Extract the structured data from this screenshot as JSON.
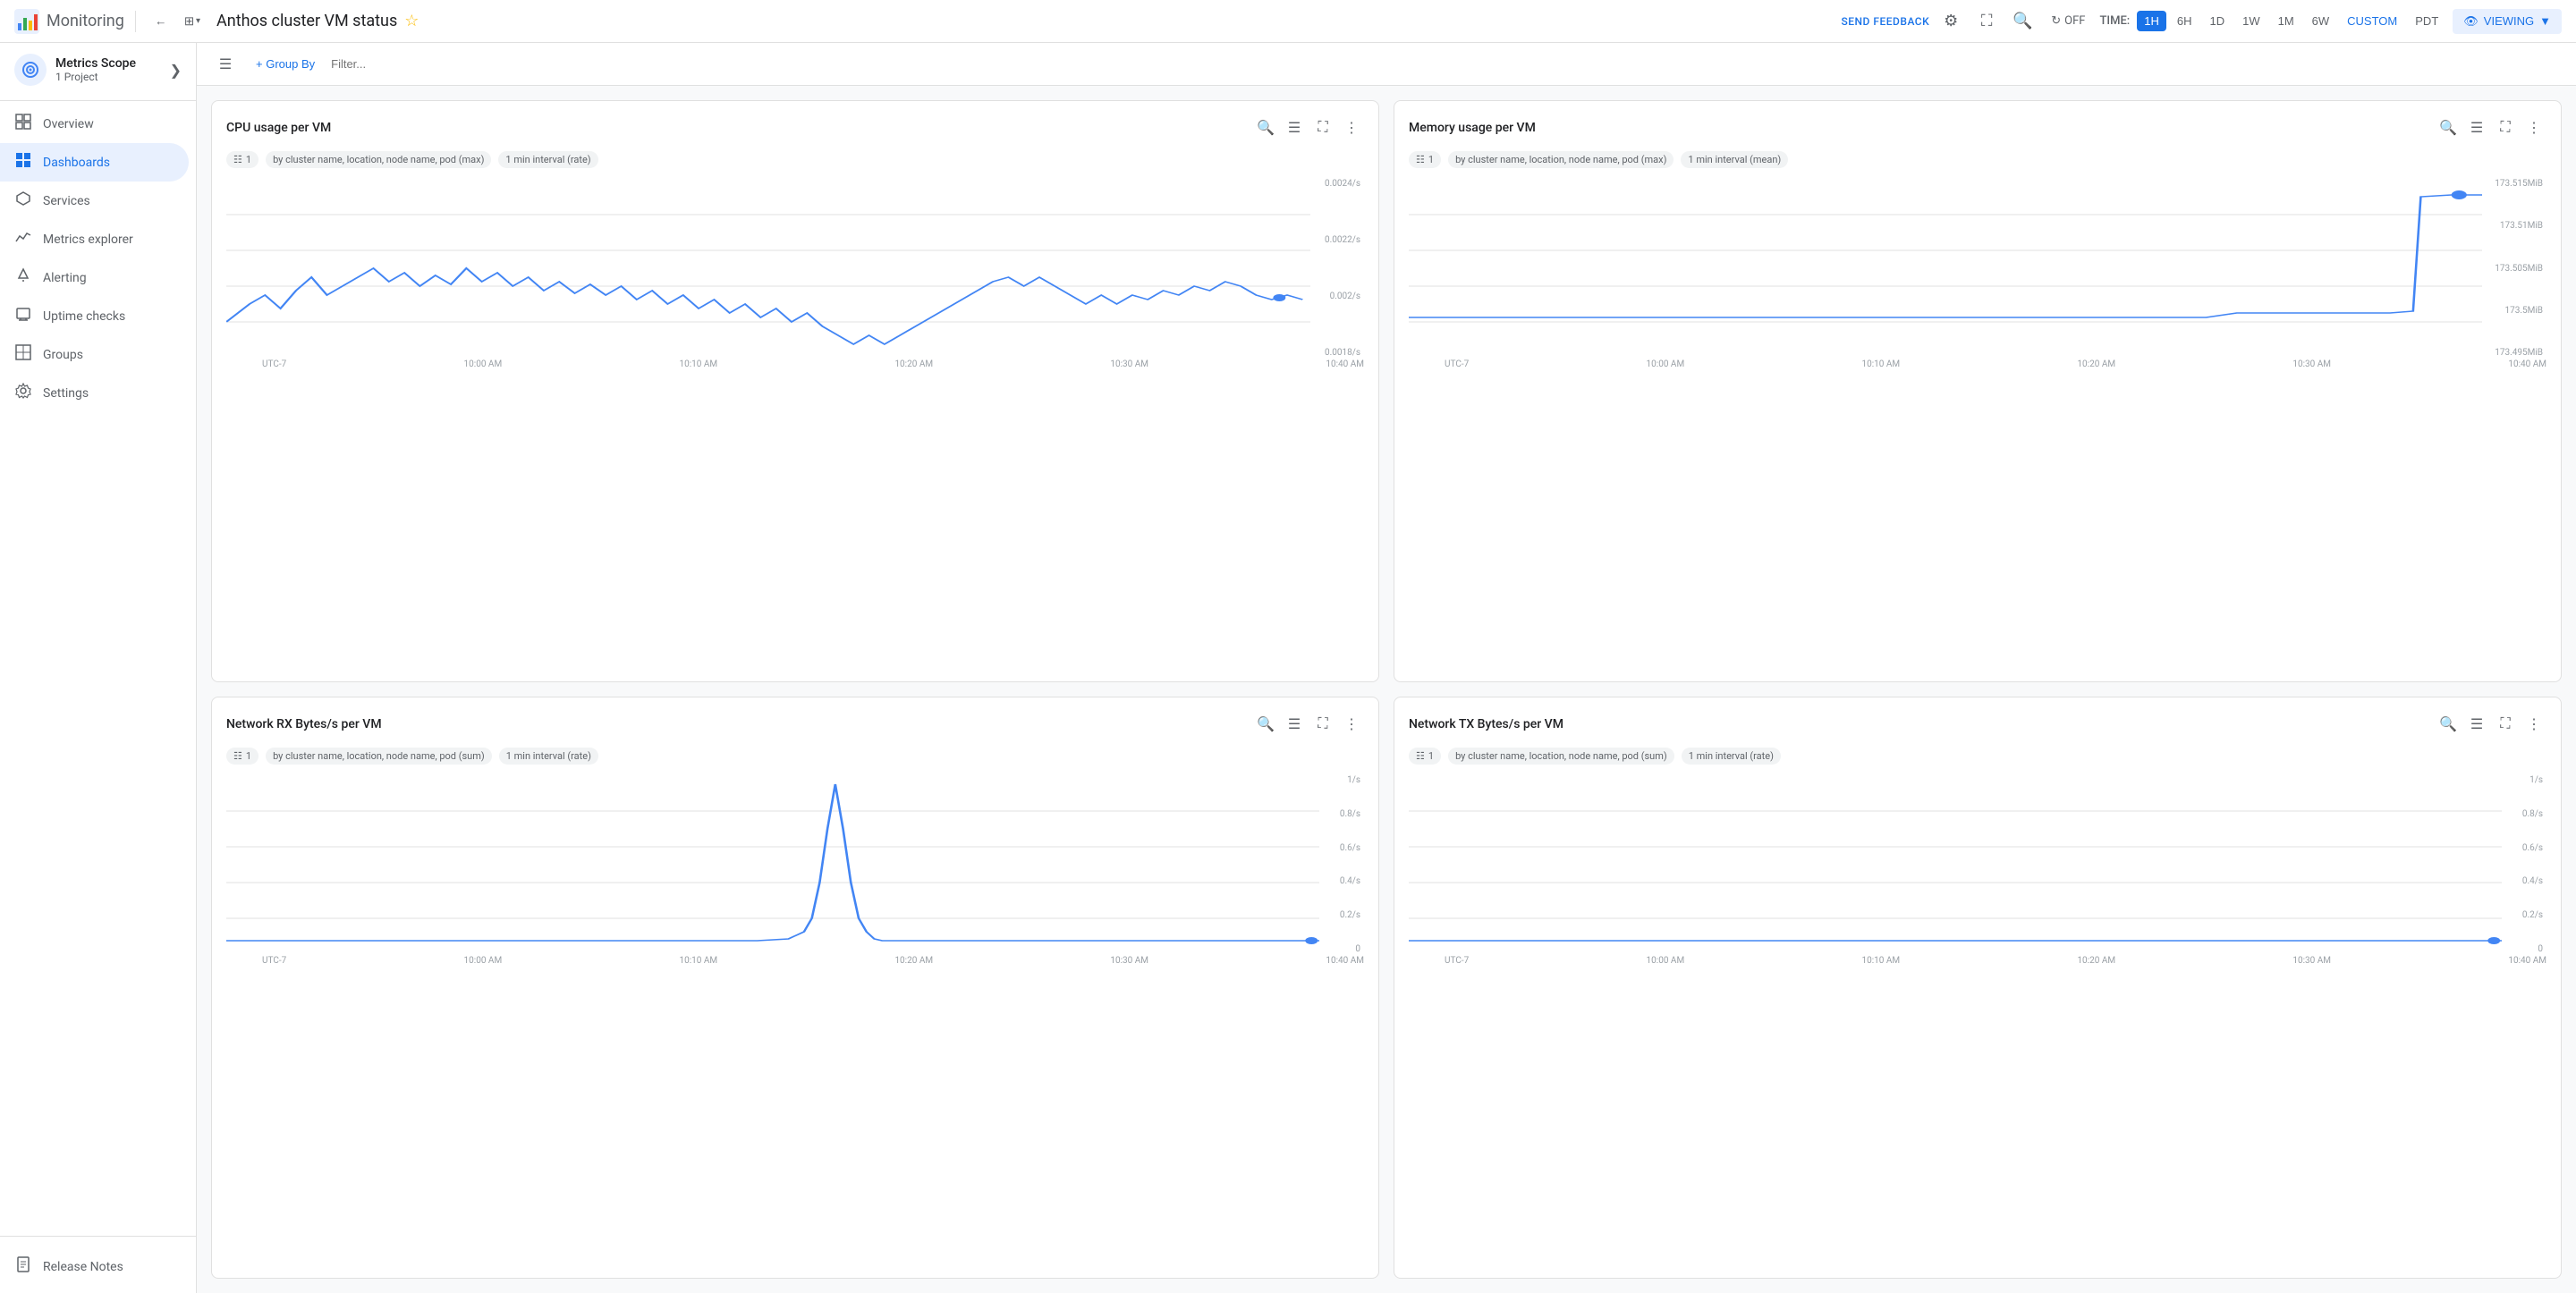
{
  "topbar": {
    "app_name": "Monitoring",
    "title": "Anthos cluster VM status",
    "feedback_label": "SEND FEEDBACK",
    "time_label": "TIME:",
    "time_options": [
      "1H",
      "6H",
      "1D",
      "1W",
      "1M",
      "6W",
      "CUSTOM",
      "PDT"
    ],
    "time_active": "1H",
    "refresh_label": "OFF",
    "viewing_label": "VIEWING"
  },
  "sidebar": {
    "header_title": "Metrics Scope",
    "header_sub": "1 Project",
    "items": [
      {
        "label": "Overview",
        "icon": "📊"
      },
      {
        "label": "Dashboards",
        "icon": "▦"
      },
      {
        "label": "Services",
        "icon": "⚡"
      },
      {
        "label": "Metrics explorer",
        "icon": "📈"
      },
      {
        "label": "Alerting",
        "icon": "🔔"
      },
      {
        "label": "Uptime checks",
        "icon": "🖥"
      },
      {
        "label": "Groups",
        "icon": "▣"
      },
      {
        "label": "Settings",
        "icon": "⚙"
      }
    ],
    "bottom_item": "Release Notes"
  },
  "toolbar": {
    "group_by": "+ Group By",
    "filter_placeholder": "Filter..."
  },
  "charts": [
    {
      "id": "cpu",
      "title": "CPU usage per VM",
      "tag1": "1",
      "tag2": "by cluster name, location, node name, pod (max)",
      "tag3": "1 min interval (rate)",
      "y_labels": [
        "0.0024/s",
        "0.0022/s",
        "0.002/s",
        "0.0018/s"
      ],
      "x_labels": [
        "UTC-7",
        "10:00 AM",
        "10:10 AM",
        "10:20 AM",
        "10:30 AM",
        "10:40 AM"
      ]
    },
    {
      "id": "memory",
      "title": "Memory usage per VM",
      "tag1": "1",
      "tag2": "by cluster name, location, node name, pod (max)",
      "tag3": "1 min interval (mean)",
      "y_labels": [
        "173.515MiB",
        "173.51MiB",
        "173.505MiB",
        "173.5MiB",
        "173.495MiB"
      ],
      "x_labels": [
        "UTC-7",
        "10:00 AM",
        "10:10 AM",
        "10:20 AM",
        "10:30 AM",
        "10:40 AM"
      ]
    },
    {
      "id": "network-rx",
      "title": "Network RX Bytes/s per VM",
      "tag1": "1",
      "tag2": "by cluster name, location, node name, pod (sum)",
      "tag3": "1 min interval (rate)",
      "y_labels": [
        "1/s",
        "0.8/s",
        "0.6/s",
        "0.4/s",
        "0.2/s",
        "0"
      ],
      "x_labels": [
        "UTC-7",
        "10:00 AM",
        "10:10 AM",
        "10:20 AM",
        "10:30 AM",
        "10:40 AM"
      ]
    },
    {
      "id": "network-tx",
      "title": "Network TX Bytes/s per VM",
      "tag1": "1",
      "tag2": "by cluster name, location, node name, pod (sum)",
      "tag3": "1 min interval (rate)",
      "y_labels": [
        "1/s",
        "0.8/s",
        "0.6/s",
        "0.4/s",
        "0.2/s",
        "0"
      ],
      "x_labels": [
        "UTC-7",
        "10:00 AM",
        "10:10 AM",
        "10:20 AM",
        "10:30 AM",
        "10:40 AM"
      ]
    }
  ]
}
